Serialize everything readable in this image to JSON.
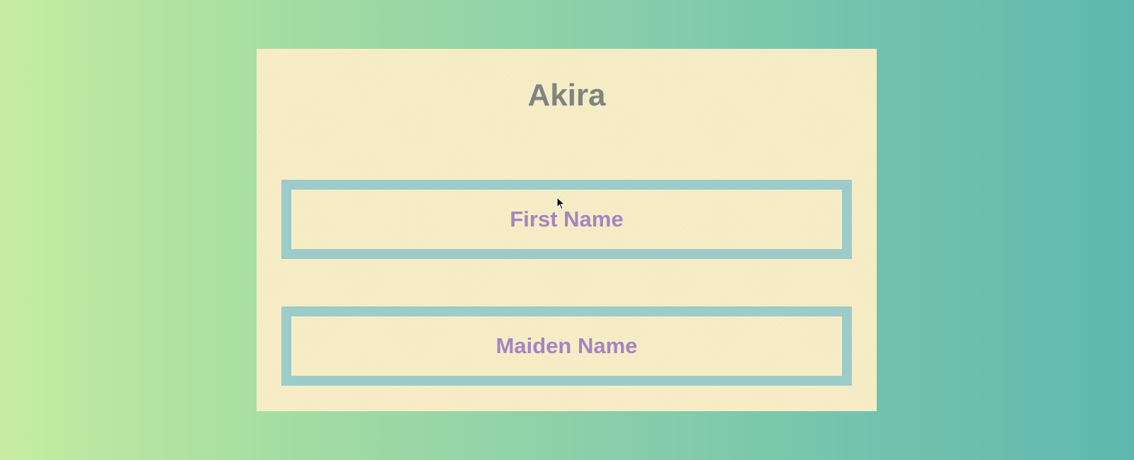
{
  "card": {
    "title": "Akira"
  },
  "fields": [
    {
      "label": "First Name"
    },
    {
      "label": "Maiden Name"
    }
  ],
  "colors": {
    "card_background": "#f8efc8",
    "title": "#7f857f",
    "field_border": "#9ccbc9",
    "field_label": "#a684c2"
  },
  "icons": {
    "pointer": "mouse-pointer-icon"
  }
}
